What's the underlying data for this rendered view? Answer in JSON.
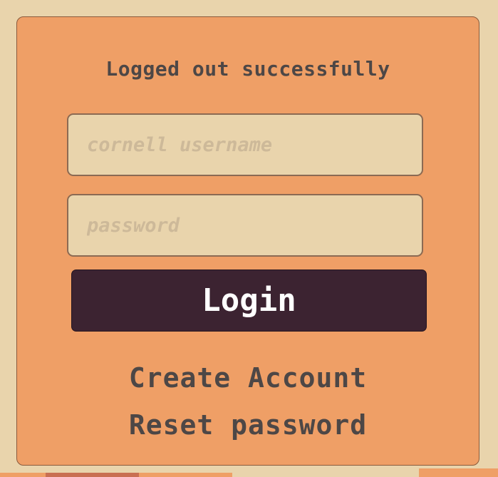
{
  "login_card": {
    "status_message": "Logged out successfully",
    "username_placeholder": "cornell username",
    "password_placeholder": "password",
    "login_label": "Login",
    "create_account_label": "Create Account",
    "reset_password_label": "Reset password"
  },
  "colors": {
    "page_background": "#e9d4ac",
    "card_background": "#ef9f66",
    "button_background": "#3c2331",
    "text": "#4d4746"
  }
}
